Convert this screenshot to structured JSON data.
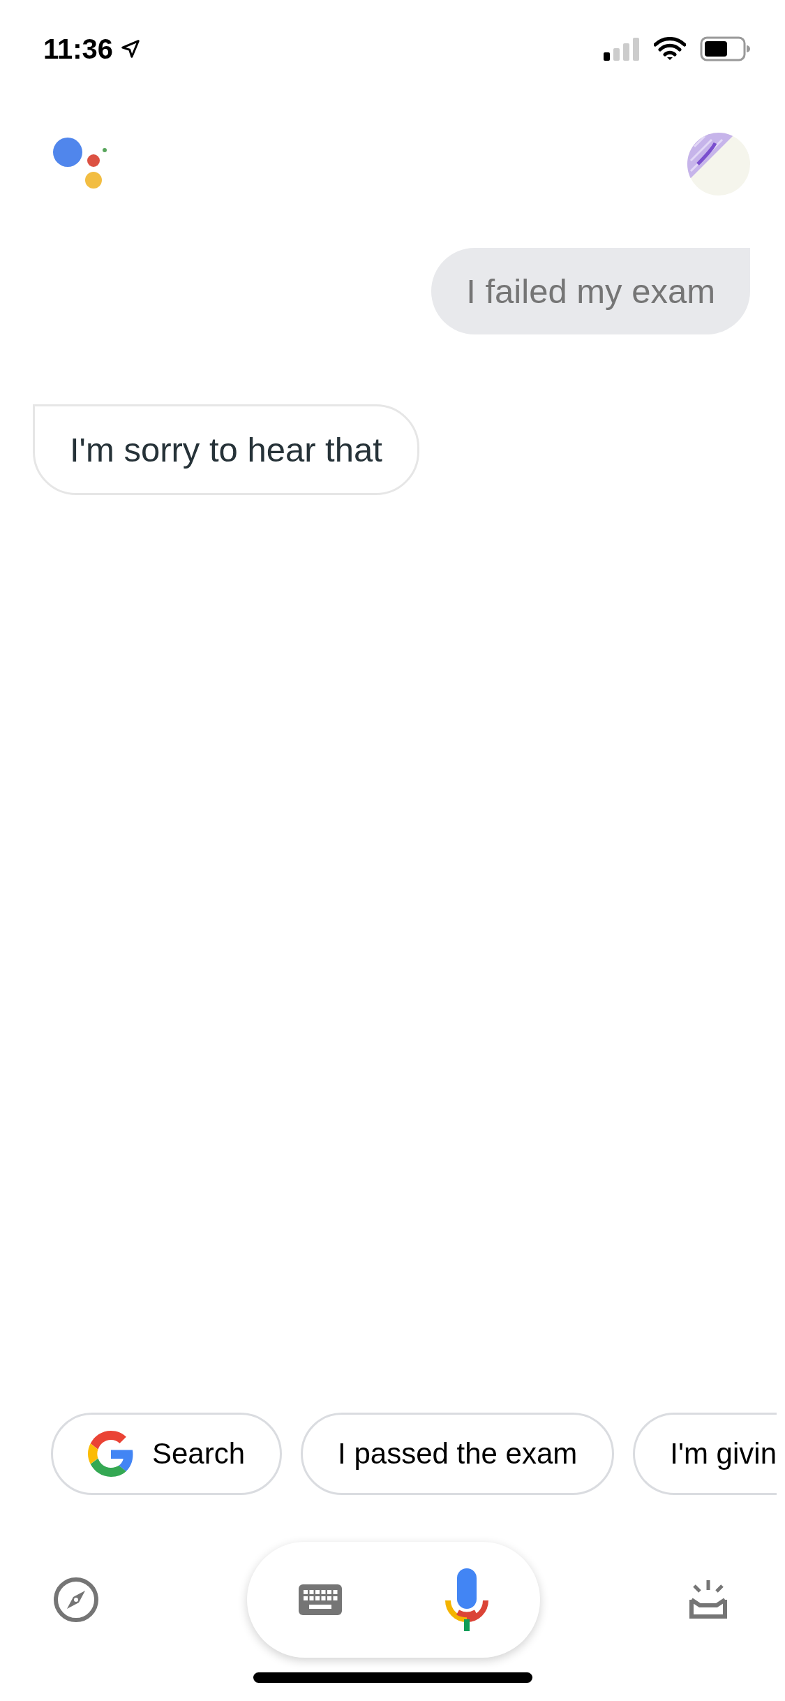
{
  "status_bar": {
    "time": "11:36"
  },
  "messages": [
    {
      "kind": "user",
      "text": "I failed my exam"
    },
    {
      "kind": "assistant",
      "text": "I'm sorry to hear that"
    }
  ],
  "suggestions": [
    {
      "kind": "search",
      "label": "Search"
    },
    {
      "kind": "text",
      "label": "I passed the exam"
    },
    {
      "kind": "text",
      "label": "I'm givin"
    }
  ]
}
